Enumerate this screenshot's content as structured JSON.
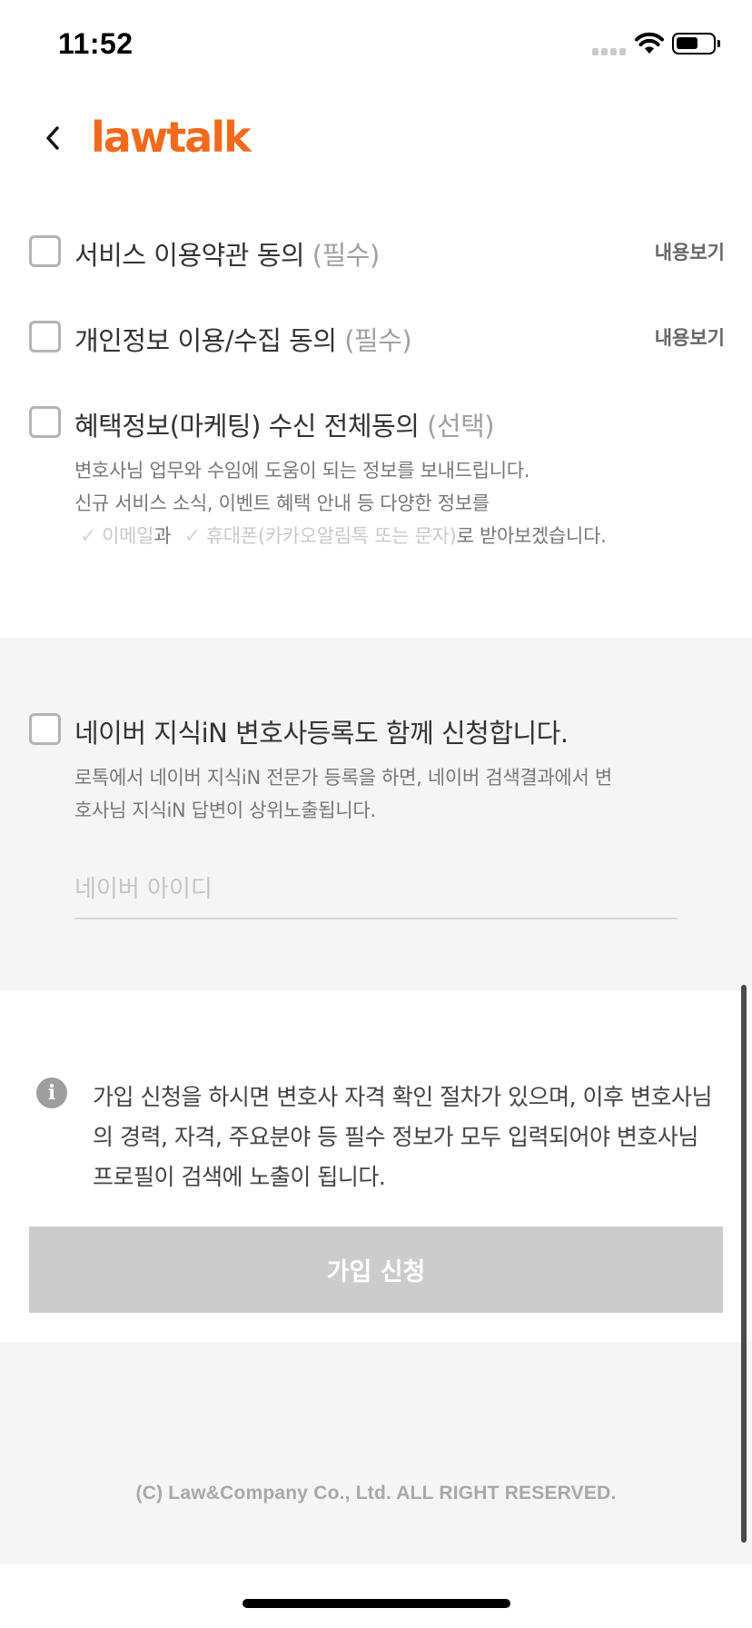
{
  "status_bar": {
    "time": "11:52"
  },
  "header": {
    "logo": "lawtalk",
    "brand_color": "#f26a1b"
  },
  "agreements": [
    {
      "label": "서비스 이용약관 동의",
      "tag": "(필수)",
      "link": "내용보기"
    },
    {
      "label": "개인정보 이용/수집 동의",
      "tag": "(필수)",
      "link": "내용보기"
    },
    {
      "label": "혜택정보(마케팅) 수신 전체동의",
      "tag": "(선택)"
    }
  ],
  "marketing": {
    "line1": "변호사님 업무와 수임에 도움이 되는 정보를 보내드립니다.",
    "line2": "신규 서비스 소식, 이벤트 혜택 안내 등 다양한 정보를",
    "email_option": "이메일",
    "connector": "과",
    "phone_option": "휴대폰(카카오알림톡 또는 문자)",
    "suffix": "로 받아보겠습니다."
  },
  "naver": {
    "label": "네이버 지식iN 변호사등록도 함께 신청합니다.",
    "desc_line1": "로톡에서 네이버 지식iN 전문가 등록을 하면, 네이버 검색결과에서 변",
    "desc_line2": "호사님 지식iN 답변이 상위노출됩니다.",
    "input_placeholder": "네이버 아이디",
    "input_value": ""
  },
  "notice": {
    "icon": "info-icon",
    "text": "가입 신청을 하시면 변호사 자격 확인 절차가 있으며, 이후 변호사님의 경력, 자격, 주요분야 등 필수 정보가 모두 입력되어야 변호사님 프로필이 검색에 노출이 됩니다."
  },
  "submit": {
    "label": "가입 신청",
    "color": "#cccccc"
  },
  "footer": {
    "copyright": "(C) Law&Company Co., Ltd. ALL RIGHT RESERVED."
  }
}
